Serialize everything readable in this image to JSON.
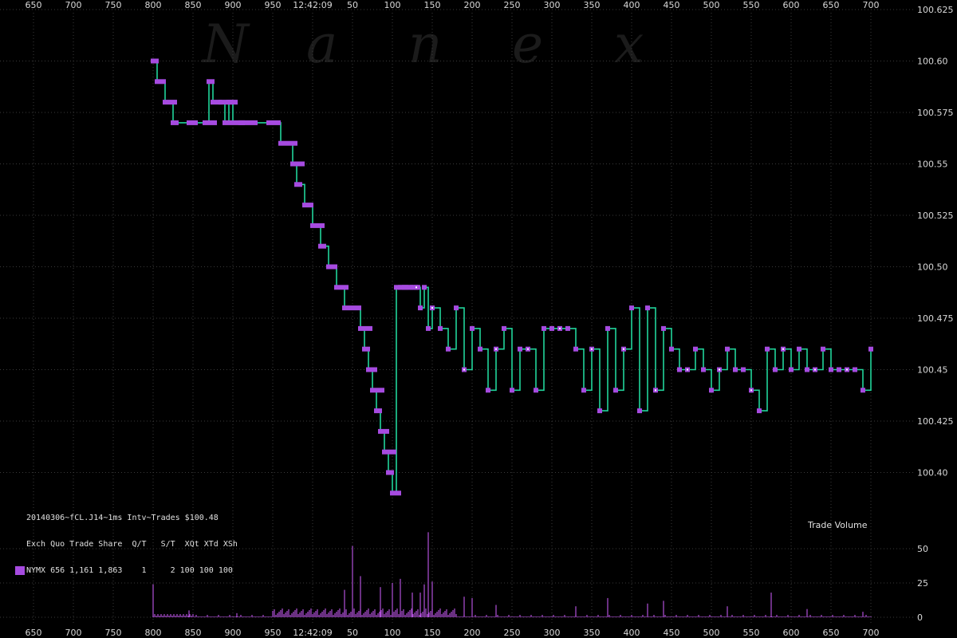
{
  "chart_data": {
    "type": "line",
    "symbol": "20140306~fCL.J14~1ms Intv~Trades $100.48",
    "watermark": [
      "N",
      "a",
      "n",
      "e",
      "x"
    ],
    "colors": {
      "background": "#000000",
      "line": "#21d49a",
      "marker": "#a64be0",
      "grid": "#3a3a3a",
      "text": "#d8d8d8",
      "volume": "#b050d8"
    },
    "x_axis": {
      "tick_labels": [
        "650",
        "700",
        "750",
        "800",
        "850",
        "900",
        "950",
        "12:42:09",
        "50",
        "100",
        "150",
        "200",
        "250",
        "300",
        "350",
        "400",
        "450",
        "500",
        "550",
        "600",
        "650",
        "700"
      ]
    },
    "price_axis": {
      "ylim": [
        100.39,
        100.625
      ],
      "tick_labels": [
        "100.625",
        "100.60",
        "100.575",
        "100.55",
        "100.525",
        "100.50",
        "100.475",
        "100.45",
        "100.425",
        "100.40"
      ]
    },
    "volume_axis": {
      "label": "Trade Volume",
      "ylim": [
        0,
        60
      ],
      "tick_labels": [
        "50",
        "25",
        "0"
      ]
    },
    "info_table": {
      "header": "Exch Quo Trade Share  Q/T   S/T  XQt XTd XSh",
      "row": "NYMX 656 1,161 1,863    1     2 100 100 100"
    },
    "price_series": {
      "name": "NYMX",
      "x": [
        800,
        805,
        815,
        825,
        845,
        865,
        870,
        875,
        885,
        890,
        895,
        900,
        910,
        920,
        945,
        960,
        970,
        975,
        980,
        990,
        1000,
        1010,
        1020,
        1030,
        1040,
        1050,
        1060,
        1065,
        1070,
        1075,
        1080,
        1085,
        1090,
        1095,
        1100,
        1105,
        1110,
        1115,
        1120,
        1125,
        1130,
        1135,
        1140,
        1145,
        1150,
        1160,
        1170,
        1180,
        1190,
        1200,
        1210,
        1220,
        1230,
        1240,
        1250,
        1260,
        1270,
        1280,
        1290,
        1300,
        1310,
        1320,
        1330,
        1340,
        1350,
        1360,
        1370,
        1380,
        1390,
        1400,
        1410,
        1420,
        1430,
        1440,
        1450,
        1460,
        1470,
        1480,
        1490,
        1500,
        1510,
        1520,
        1530,
        1540,
        1550,
        1560,
        1570,
        1580,
        1590,
        1600,
        1610,
        1620,
        1630,
        1640,
        1650,
        1660,
        1670,
        1680,
        1690,
        1700
      ],
      "y": [
        100.6,
        100.59,
        100.58,
        100.57,
        100.57,
        100.57,
        100.59,
        100.58,
        100.58,
        100.57,
        100.58,
        100.57,
        100.57,
        100.57,
        100.57,
        100.56,
        100.56,
        100.55,
        100.54,
        100.53,
        100.52,
        100.51,
        100.5,
        100.49,
        100.48,
        100.48,
        100.47,
        100.46,
        100.45,
        100.44,
        100.43,
        100.42,
        100.41,
        100.4,
        100.39,
        100.49,
        100.49,
        100.49,
        100.49,
        100.49,
        100.49,
        100.48,
        100.49,
        100.47,
        100.48,
        100.47,
        100.46,
        100.48,
        100.45,
        100.47,
        100.46,
        100.44,
        100.46,
        100.47,
        100.44,
        100.46,
        100.46,
        100.44,
        100.47,
        100.47,
        100.47,
        100.47,
        100.46,
        100.44,
        100.46,
        100.43,
        100.47,
        100.44,
        100.46,
        100.48,
        100.43,
        100.48,
        100.44,
        100.47,
        100.46,
        100.45,
        100.45,
        100.46,
        100.45,
        100.44,
        100.45,
        100.46,
        100.45,
        100.45,
        100.44,
        100.43,
        100.46,
        100.45,
        100.46,
        100.45,
        100.46,
        100.45,
        100.45,
        100.46,
        100.45,
        100.45,
        100.45,
        100.45,
        100.44,
        100.46
      ]
    },
    "volume_series": {
      "name": "Trade Volume",
      "spikes": [
        {
          "x": 800,
          "v": 24
        },
        {
          "x": 845,
          "v": 5
        },
        {
          "x": 905,
          "v": 3
        },
        {
          "x": 1040,
          "v": 20
        },
        {
          "x": 1050,
          "v": 52
        },
        {
          "x": 1060,
          "v": 30
        },
        {
          "x": 1085,
          "v": 22
        },
        {
          "x": 1100,
          "v": 25
        },
        {
          "x": 1110,
          "v": 28
        },
        {
          "x": 1125,
          "v": 18
        },
        {
          "x": 1135,
          "v": 18
        },
        {
          "x": 1140,
          "v": 24
        },
        {
          "x": 1145,
          "v": 62
        },
        {
          "x": 1150,
          "v": 26
        },
        {
          "x": 1190,
          "v": 15
        },
        {
          "x": 1200,
          "v": 14
        },
        {
          "x": 1230,
          "v": 9
        },
        {
          "x": 1330,
          "v": 8
        },
        {
          "x": 1370,
          "v": 14
        },
        {
          "x": 1420,
          "v": 10
        },
        {
          "x": 1440,
          "v": 12
        },
        {
          "x": 1520,
          "v": 8
        },
        {
          "x": 1575,
          "v": 18
        },
        {
          "x": 1620,
          "v": 6
        },
        {
          "x": 1690,
          "v": 4
        }
      ]
    }
  }
}
